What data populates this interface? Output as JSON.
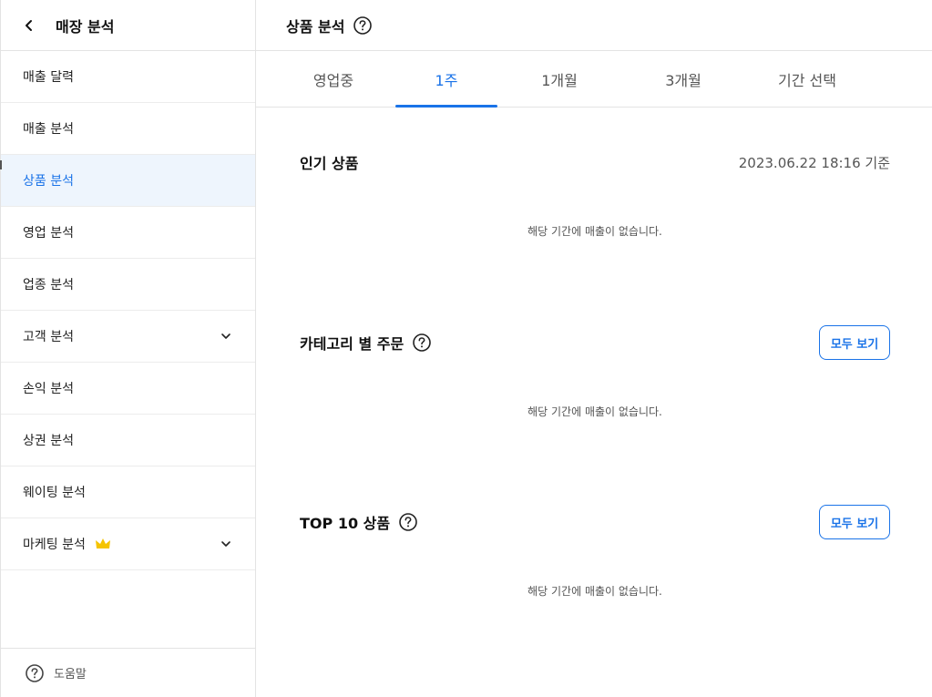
{
  "sidebar": {
    "title": "매장 분석",
    "items": [
      {
        "label": "매출 달력"
      },
      {
        "label": "매출 분석"
      },
      {
        "label": "상품 분석"
      },
      {
        "label": "영업 분석"
      },
      {
        "label": "업종 분석"
      },
      {
        "label": "고객 분석"
      },
      {
        "label": "손익 분석"
      },
      {
        "label": "상권 분석"
      },
      {
        "label": "웨이팅 분석"
      },
      {
        "label": "마케팅 분석"
      }
    ],
    "footer_label": "도움말"
  },
  "main": {
    "title": "상품 분석",
    "tabs": [
      {
        "label": "영업중"
      },
      {
        "label": "1주"
      },
      {
        "label": "1개월"
      },
      {
        "label": "3개월"
      },
      {
        "label": "기간 선택"
      }
    ],
    "active_tab": "1주",
    "sections": {
      "popular": {
        "title": "인기 상품",
        "timestamp": "2023.06.22 18:16 기준",
        "empty_text": "해당 기간에 매출이 없습니다."
      },
      "category": {
        "title": "카테고리 별 주문",
        "view_all": "모두 보기",
        "empty_text": "해당 기간에 매출이 없습니다."
      },
      "top10": {
        "title": "TOP 10 상품",
        "view_all": "모두 보기",
        "empty_text": "해당 기간에 매출이 없습니다."
      }
    }
  },
  "colors": {
    "accent": "#1a73e8",
    "active_bg": "#eef5fd",
    "crown": "#f5c400"
  }
}
